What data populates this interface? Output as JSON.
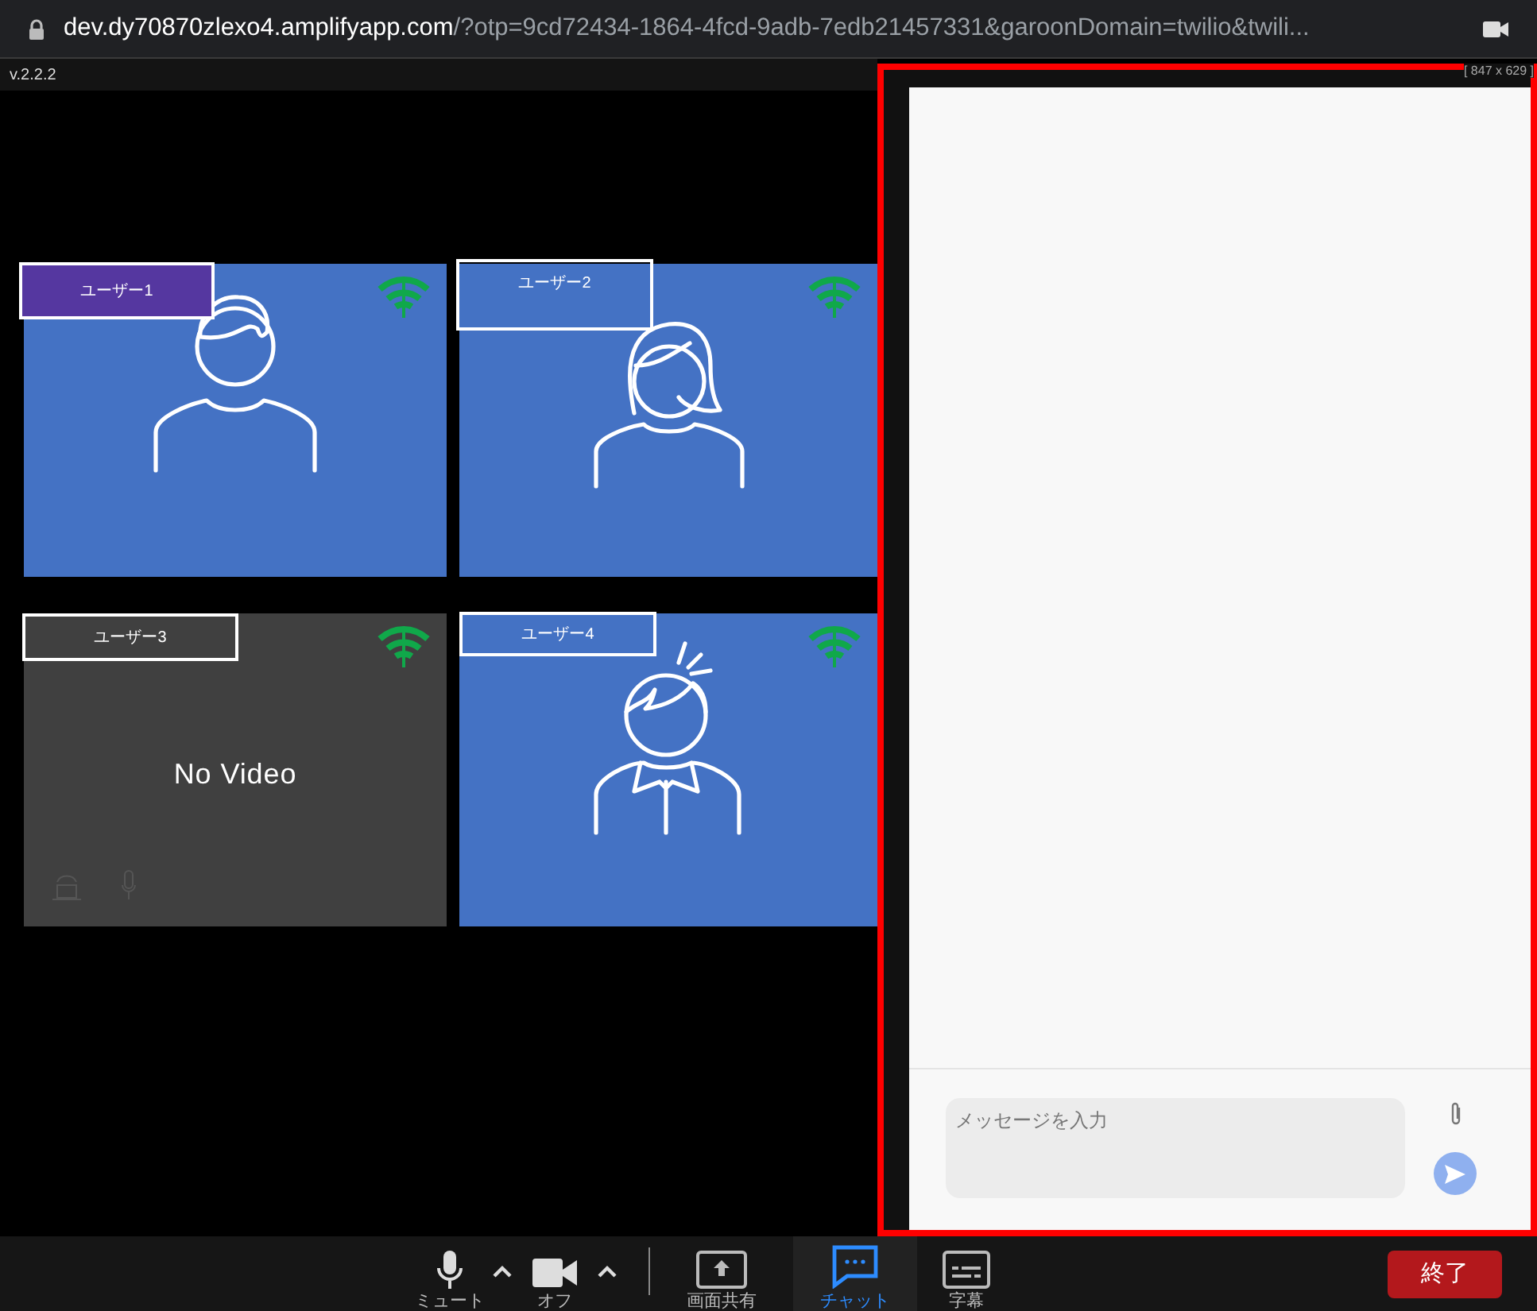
{
  "browser": {
    "url_host": "dev.dy70870zlexo4.amplifyapp.com",
    "url_rest": "/?otp=9cd72434-1864-4fcd-9adb-7edb21457331&garoonDomain=twilio&twili..."
  },
  "version": "v.2.2.2",
  "viewport_size": "[ 847 x 629 ]",
  "participants": [
    {
      "name": "ユーザー1",
      "kind": "video",
      "highlighted": true
    },
    {
      "name": "ユーザー2",
      "kind": "video",
      "highlighted": false
    },
    {
      "name": "ユーザー3",
      "kind": "no_video",
      "highlighted": false,
      "status_text": "No Video"
    },
    {
      "name": "ユーザー4",
      "kind": "video",
      "highlighted": false
    }
  ],
  "chat": {
    "placeholder": "メッセージを入力"
  },
  "toolbar": {
    "items": [
      {
        "label": "ミュート",
        "kind": "mic",
        "caret": true,
        "selected": false
      },
      {
        "label": "オフ",
        "kind": "camera",
        "caret": true,
        "selected": false
      },
      {
        "label": "画面共有",
        "kind": "share",
        "caret": false,
        "selected": false
      },
      {
        "label": "チャット",
        "kind": "chat",
        "caret": false,
        "selected": true
      },
      {
        "label": "字幕",
        "kind": "captions",
        "caret": false,
        "selected": false
      }
    ],
    "end_button": "終了"
  }
}
